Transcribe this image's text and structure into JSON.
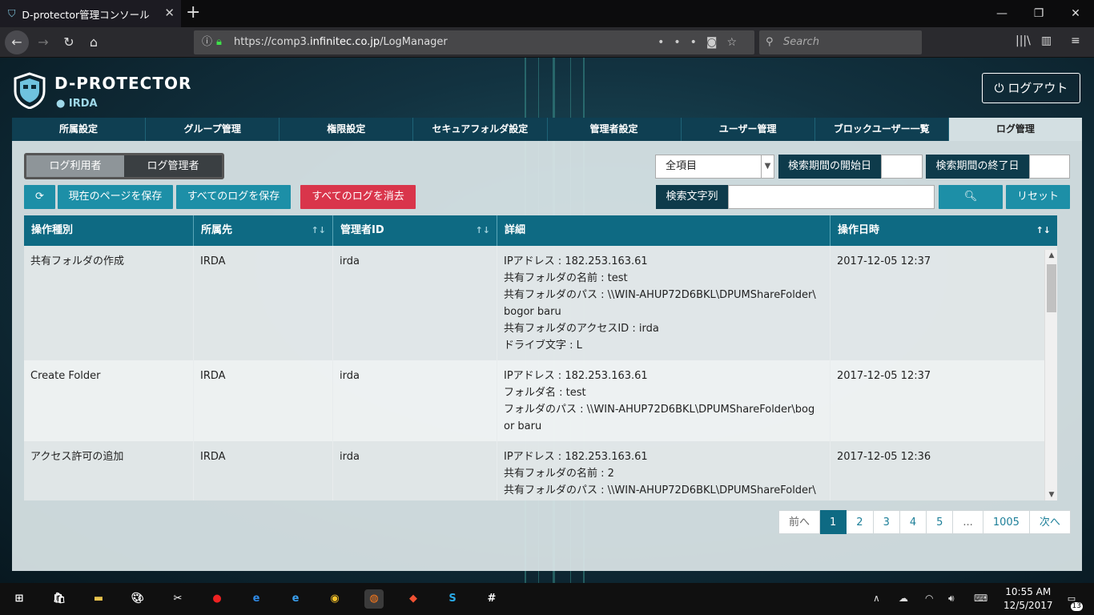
{
  "browser": {
    "tab_title": "D-protector管理コンソール",
    "url_prefix": "https://comp3.",
    "url_host": "infinitec.co.jp",
    "url_path": "/LogManager",
    "search_placeholder": "Search"
  },
  "header": {
    "brand": "D-PROTECTOR",
    "org": "IRDA",
    "logout_label": "ログアウト"
  },
  "nav": {
    "tabs": [
      "所属設定",
      "グループ管理",
      "権限設定",
      "セキュアフォルダ設定",
      "管理者設定",
      "ユーザー管理",
      "ブロックユーザー一覧",
      "ログ管理"
    ],
    "active": "ログ管理"
  },
  "toolbar": {
    "seg_user": "ログ利用者",
    "seg_admin": "ログ管理者",
    "save_page": "現在のページを保存",
    "save_all": "すべてのログを保存",
    "delete_all": "すべてのログを消去",
    "filter_select": "全項目",
    "start_label": "検索期間の開始日",
    "end_label": "検索期間の終了日",
    "search_label": "検索文字列",
    "reset_label": "リセット"
  },
  "table": {
    "headers": [
      "操作種別",
      "所属先",
      "管理者ID",
      "詳細",
      "操作日時"
    ],
    "rows": [
      {
        "type": "共有フォルダの作成",
        "org": "IRDA",
        "admin": "irda",
        "details": [
          "IPアドレス : 182.253.163.61",
          "共有フォルダの名前 : test",
          "共有フォルダのパス : \\\\WIN-AHUP72D6BKL\\DPUMShareFolder\\",
          "bogor baru",
          "共有フォルダのアクセスID : irda",
          "ドライブ文字 : L"
        ],
        "datetime": "2017-12-05 12:37"
      },
      {
        "type": "Create Folder",
        "org": "IRDA",
        "admin": "irda",
        "details": [
          "IPアドレス : 182.253.163.61",
          "フォルダ名 : test",
          "フォルダのパス : \\\\WIN-AHUP72D6BKL\\DPUMShareFolder\\bog",
          "or baru"
        ],
        "datetime": "2017-12-05 12:37"
      },
      {
        "type": "アクセス許可の追加",
        "org": "IRDA",
        "admin": "irda",
        "details": [
          "IPアドレス : 182.253.163.61",
          "共有フォルダの名前 : 2",
          "共有フォルダのパス : \\\\WIN-AHUP72D6BKL\\DPUMShareFolder\\"
        ],
        "datetime": "2017-12-05 12:36"
      }
    ]
  },
  "pager": {
    "prev": "前へ",
    "pages": [
      "1",
      "2",
      "3",
      "4",
      "5",
      "...",
      "1005"
    ],
    "current": "1",
    "next": "次へ"
  },
  "taskbar": {
    "time": "10:55 AM",
    "date": "12/5/2017",
    "notifications": "13"
  },
  "colors": {
    "accent": "#1d8fa7",
    "header_row": "#0e6a83",
    "danger": "#d9354b",
    "nav_bg": "#0f3f52"
  }
}
